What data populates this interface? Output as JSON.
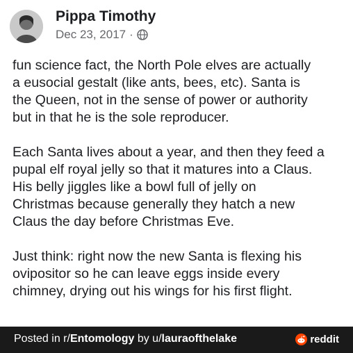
{
  "post": {
    "author": "Pippa Timothy",
    "date": "Dec 23, 2017",
    "separator": "·",
    "visibility_icon": "globe-icon",
    "paragraphs": [
      {
        "lines": [
          "fun science fact, the North Pole elves are actually",
          "a eusocial gestalt (like ants, bees, etc). Santa is",
          "the Queen, not in the sense of power or authority",
          "but in that he is the sole reproducer."
        ]
      },
      {
        "lines": [
          "Each Santa lives about a year, and then they feed a",
          "pupal elf royal jelly so that it matures into a Claus.",
          "His belly jiggles like a bowl full of jelly on",
          "Christmas because generally they hatch a new",
          "Claus the day before Christmas Eve."
        ]
      },
      {
        "lines": [
          "Just think: right now the new Santa is flexing his",
          "ovipositor so he can leave eggs inside every",
          "chimney, drying out his wings for his first flight."
        ]
      }
    ]
  },
  "footer": {
    "posted_in": "Posted in r/",
    "subreddit": "Entomology",
    "by": " by u/",
    "user": "lauraofthelake",
    "brand": "reddit",
    "brand_icon": "reddit-logo-icon",
    "background": "#1a1a1b",
    "brand_color": "#ff4500"
  }
}
